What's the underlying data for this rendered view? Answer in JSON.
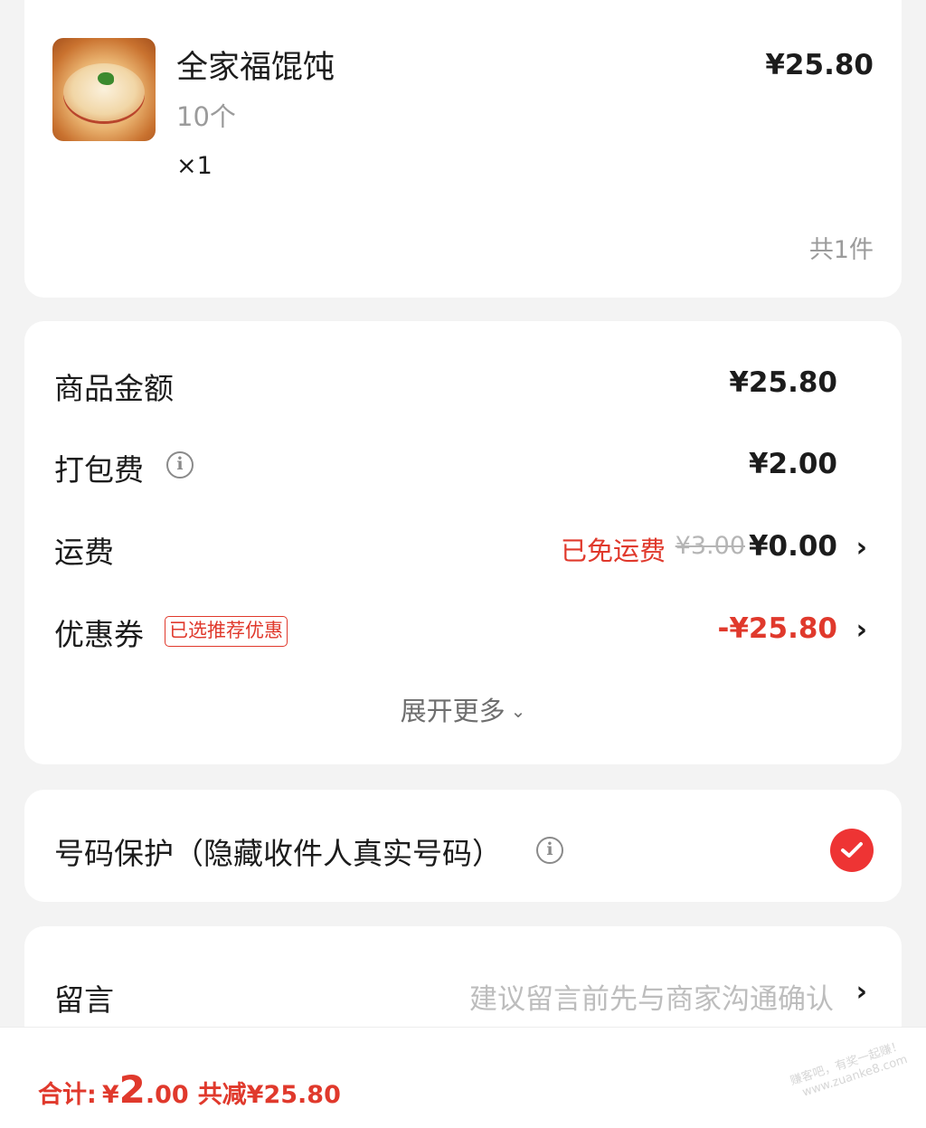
{
  "product": {
    "name": "全家福馄饨",
    "spec": "10个",
    "qty": "×1",
    "price": "¥25.80",
    "total_count": "共1件"
  },
  "fees": {
    "goods_label": "商品金额",
    "goods_value": "¥25.80",
    "packing_label": "打包费",
    "packing_value": "¥2.00",
    "shipping_label": "运费",
    "shipping_free_tag": "已免运费",
    "shipping_original": "¥3.00",
    "shipping_value": "¥0.00",
    "coupon_label": "优惠券",
    "coupon_tag": "已选推荐优惠",
    "coupon_value": "-¥25.80",
    "expand_label": "展开更多",
    "info_glyph": "i",
    "chevron_glyph": "›",
    "caret_glyph": "⌄"
  },
  "phone_protection": {
    "label": "号码保护（隐藏收件人真实号码）",
    "checked": true
  },
  "message": {
    "label": "留言",
    "placeholder": "建议留言前先与商家沟通确认"
  },
  "bottom_bar": {
    "total_label": "合计:",
    "currency": "¥",
    "amount_int": "2",
    "amount_dec": ".00",
    "reduction": "共减¥25.80"
  },
  "watermark": {
    "line1": "赚客吧，有奖一起赚！",
    "line2": "www.zuanke8.com"
  },
  "colors": {
    "accent_red": "#e0392c",
    "check_red": "#ee3434",
    "background": "#f3f3f3"
  }
}
